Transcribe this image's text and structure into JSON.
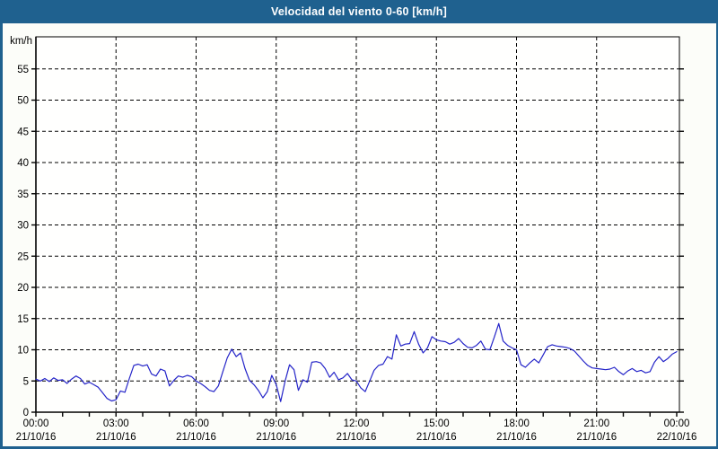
{
  "window": {
    "title": "Velocidad del viento 0-60 [km/h]"
  },
  "colors": {
    "titlebar_bg": "#1f618f",
    "titlebar_text": "#ffffff",
    "frame_border": "#1f618f",
    "chart_bg": "#fcfdf9",
    "plot_bg": "#fffffe",
    "axis": "#000000",
    "grid": "#000000",
    "series_line": "#2424c8",
    "label_text": "#000000"
  },
  "chart_data": {
    "type": "line",
    "title": "Velocidad del viento 0-60 [km/h]",
    "xlabel": "",
    "ylabel": "km/h",
    "ylim": [
      0,
      60
    ],
    "y_ticks": [
      0,
      5,
      10,
      15,
      20,
      25,
      30,
      35,
      40,
      45,
      50,
      55
    ],
    "xlim_hours": [
      0,
      24
    ],
    "x_minor_tick_interval_hours": 1,
    "grid": "dashed",
    "legend": "none",
    "x_major_ticks": [
      {
        "hour": 0,
        "time": "00:00",
        "date": "21/10/16"
      },
      {
        "hour": 3,
        "time": "03:00",
        "date": "21/10/16"
      },
      {
        "hour": 6,
        "time": "06:00",
        "date": "21/10/16"
      },
      {
        "hour": 9,
        "time": "09:00",
        "date": "21/10/16"
      },
      {
        "hour": 12,
        "time": "12:00",
        "date": "21/10/16"
      },
      {
        "hour": 15,
        "time": "15:00",
        "date": "21/10/16"
      },
      {
        "hour": 18,
        "time": "18:00",
        "date": "21/10/16"
      },
      {
        "hour": 21,
        "time": "21:00",
        "date": "21/10/16"
      },
      {
        "hour": 24,
        "time": "00:00",
        "date": "22/10/16"
      }
    ],
    "series": [
      {
        "name": "Velocidad del viento",
        "unit": "km/h",
        "color": "#2424c8",
        "start_hour": 0,
        "sample_interval_minutes": 10,
        "values": [
          5.3,
          5.0,
          5.4,
          4.9,
          5.5,
          5.1,
          5.2,
          4.6,
          5.3,
          5.8,
          5.4,
          4.5,
          4.8,
          4.4,
          4.0,
          3.1,
          2.2,
          1.8,
          2.0,
          3.4,
          3.2,
          5.4,
          7.5,
          7.7,
          7.4,
          7.6,
          6.1,
          5.8,
          6.9,
          6.6,
          4.2,
          5.1,
          5.8,
          5.6,
          5.9,
          5.7,
          5.0,
          4.6,
          4.1,
          3.5,
          3.3,
          4.2,
          6.5,
          8.7,
          10.1,
          8.9,
          9.5,
          7.0,
          5.1,
          4.4,
          3.5,
          2.3,
          3.3,
          5.9,
          4.4,
          1.7,
          5.0,
          7.6,
          6.8,
          3.5,
          5.2,
          4.8,
          8.0,
          8.1,
          7.9,
          7.0,
          5.6,
          6.4,
          5.2,
          5.5,
          6.2,
          5.2,
          5.0,
          3.9,
          3.3,
          5.0,
          6.7,
          7.5,
          7.7,
          8.9,
          8.5,
          12.4,
          10.6,
          10.9,
          11.0,
          12.9,
          10.9,
          9.5,
          10.3,
          12.1,
          11.6,
          11.4,
          11.3,
          10.9,
          11.2,
          11.8,
          11.0,
          10.4,
          10.3,
          10.7,
          11.4,
          10.1,
          10.0,
          12.0,
          14.2,
          11.4,
          10.7,
          10.3,
          10.0,
          7.6,
          7.2,
          7.9,
          8.5,
          7.9,
          9.2,
          10.5,
          10.8,
          10.6,
          10.5,
          10.4,
          10.2,
          9.8,
          9.0,
          8.2,
          7.5,
          7.1,
          7.0,
          6.9,
          6.8,
          6.9,
          7.2,
          6.5,
          6.0,
          6.6,
          7.0,
          6.5,
          6.7,
          6.3,
          6.5,
          8.0,
          8.9,
          8.1,
          8.6,
          9.3,
          9.7
        ]
      }
    ]
  }
}
